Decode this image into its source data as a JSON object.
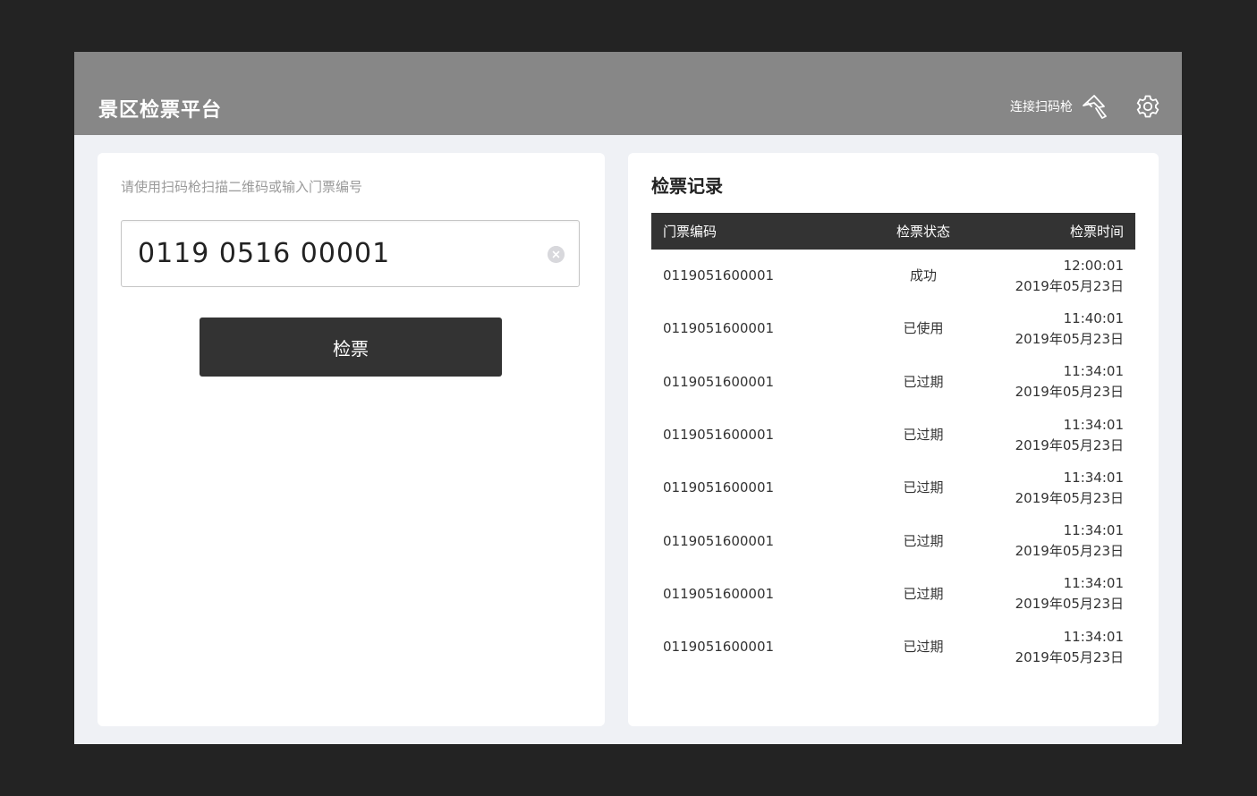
{
  "header": {
    "title": "景区检票平台",
    "scanner_label": "连接扫码枪",
    "scanner_icon": "scanner-gun-icon",
    "settings_icon": "gear-icon"
  },
  "check_panel": {
    "hint": "请使用扫码枪扫描二维码或输入门票编号",
    "ticket_value": "0119 0516 00001",
    "clear_icon": "clear-icon",
    "check_button_label": "检票"
  },
  "records": {
    "title": "检票记录",
    "columns": {
      "code": "门票编码",
      "status": "检票状态",
      "time": "检票时间"
    },
    "rows": [
      {
        "code": "0119051600001",
        "status": "成功",
        "time": "12:00:01",
        "date": "2019年05月23日"
      },
      {
        "code": "0119051600001",
        "status": "已使用",
        "time": "11:40:01",
        "date": "2019年05月23日"
      },
      {
        "code": "0119051600001",
        "status": "已过期",
        "time": "11:34:01",
        "date": "2019年05月23日"
      },
      {
        "code": "0119051600001",
        "status": "已过期",
        "time": "11:34:01",
        "date": "2019年05月23日"
      },
      {
        "code": "0119051600001",
        "status": "已过期",
        "time": "11:34:01",
        "date": "2019年05月23日"
      },
      {
        "code": "0119051600001",
        "status": "已过期",
        "time": "11:34:01",
        "date": "2019年05月23日"
      },
      {
        "code": "0119051600001",
        "status": "已过期",
        "time": "11:34:01",
        "date": "2019年05月23日"
      },
      {
        "code": "0119051600001",
        "status": "已过期",
        "time": "11:34:01",
        "date": "2019年05月23日"
      }
    ]
  },
  "colors": {
    "header_bg": "#878787",
    "page_bg": "#eff1f5",
    "dark": "#333333",
    "backdrop": "#232323"
  }
}
